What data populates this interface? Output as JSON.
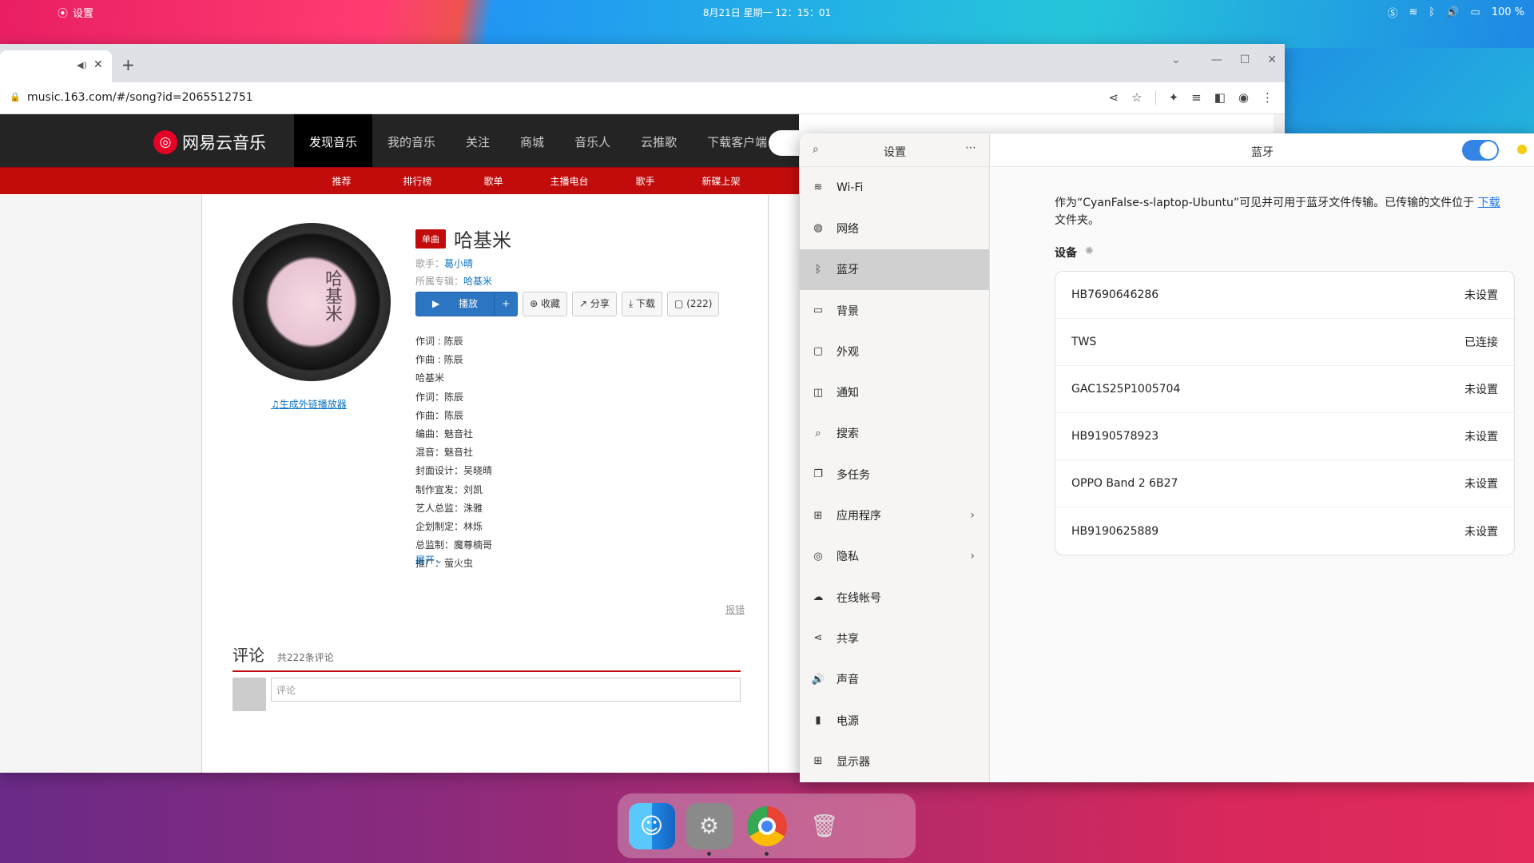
{
  "topbar": {
    "app": "设置",
    "clock": "8月21日 星期一  12：15：01",
    "battery": "100 %"
  },
  "chrome": {
    "url": "music.163.com/#/song?id=2065512751"
  },
  "netease": {
    "logo": "网易云音乐",
    "nav": [
      "发现音乐",
      "我的音乐",
      "关注",
      "商城",
      "音乐人",
      "云推歌",
      "下载客户端"
    ],
    "subnav": [
      "推荐",
      "排行榜",
      "歌单",
      "主播电台",
      "歌手",
      "新碟上架"
    ],
    "disc_text": "哈基米",
    "gen_link": "生成外链播放器",
    "badge": "单曲",
    "song": "哈基米",
    "singer_label": "歌手：",
    "singer": "葛小晴",
    "album_label": "所属专辑：",
    "album": "哈基米",
    "buttons": {
      "play": "播放",
      "plus": "+",
      "collect": "收藏",
      "share": "分享",
      "download": "下载",
      "comment": "(222)"
    },
    "lyrics": [
      "作词 : 陈辰",
      "作曲 : 陈辰",
      "哈基米",
      "作词：陈辰",
      "作曲：陈辰",
      "编曲：魅音社",
      "混音：魅音社",
      "封面设计：吴晓晴",
      "制作宣发：刘凯",
      "艺人总监：洙雅",
      "企划制定：林烁",
      "总监制：魔尊楠哥",
      "推广：萤火虫"
    ],
    "expand": "展开",
    "report": "报错",
    "comments_title": "评论",
    "comments_count": "共222条评论",
    "comment_placeholder": "评论"
  },
  "settings": {
    "sidebar_title": "设置",
    "items": [
      {
        "icon": "wifi-icon",
        "glyph": "≋",
        "label": "Wi-Fi"
      },
      {
        "icon": "network-icon",
        "glyph": "◍",
        "label": "网络"
      },
      {
        "icon": "bluetooth-icon",
        "glyph": "ᛒ",
        "label": "蓝牙"
      },
      {
        "icon": "background-icon",
        "glyph": "▭",
        "label": "背景"
      },
      {
        "icon": "appearance-icon",
        "glyph": "▢",
        "label": "外观"
      },
      {
        "icon": "notification-icon",
        "glyph": "◫",
        "label": "通知"
      },
      {
        "icon": "search-icon",
        "glyph": "⌕",
        "label": "搜索"
      },
      {
        "icon": "multitask-icon",
        "glyph": "❐",
        "label": "多任务"
      },
      {
        "icon": "apps-icon",
        "glyph": "⊞",
        "label": "应用程序"
      },
      {
        "icon": "privacy-icon",
        "glyph": "◎",
        "label": "隐私"
      },
      {
        "icon": "cloud-icon",
        "glyph": "☁",
        "label": "在线帐号"
      },
      {
        "icon": "share-icon",
        "glyph": "⋖",
        "label": "共享"
      },
      {
        "icon": "sound-icon",
        "glyph": "🔊",
        "label": "声音"
      },
      {
        "icon": "power-icon",
        "glyph": "▮",
        "label": "电源"
      },
      {
        "icon": "display-icon",
        "glyph": "⊞",
        "label": "显示器"
      }
    ],
    "pane_title": "蓝牙",
    "desc_text": "作为“CyanFalse-s-laptop-Ubuntu”可见并可用于蓝牙文件传输。已传输的文件位于 ",
    "desc_link": "下载",
    "desc_tail": "文件夹。",
    "devices_title": "设备",
    "devices": [
      {
        "name": "HB7690646286",
        "status": "未设置"
      },
      {
        "name": "TWS",
        "status": "已连接"
      },
      {
        "name": "GAC1S25P1005704",
        "status": "未设置"
      },
      {
        "name": "HB9190578923",
        "status": "未设置"
      },
      {
        "name": "OPPO Band 2 6B27",
        "status": "未设置"
      },
      {
        "name": "HB9190625889",
        "status": "未设置"
      }
    ]
  }
}
